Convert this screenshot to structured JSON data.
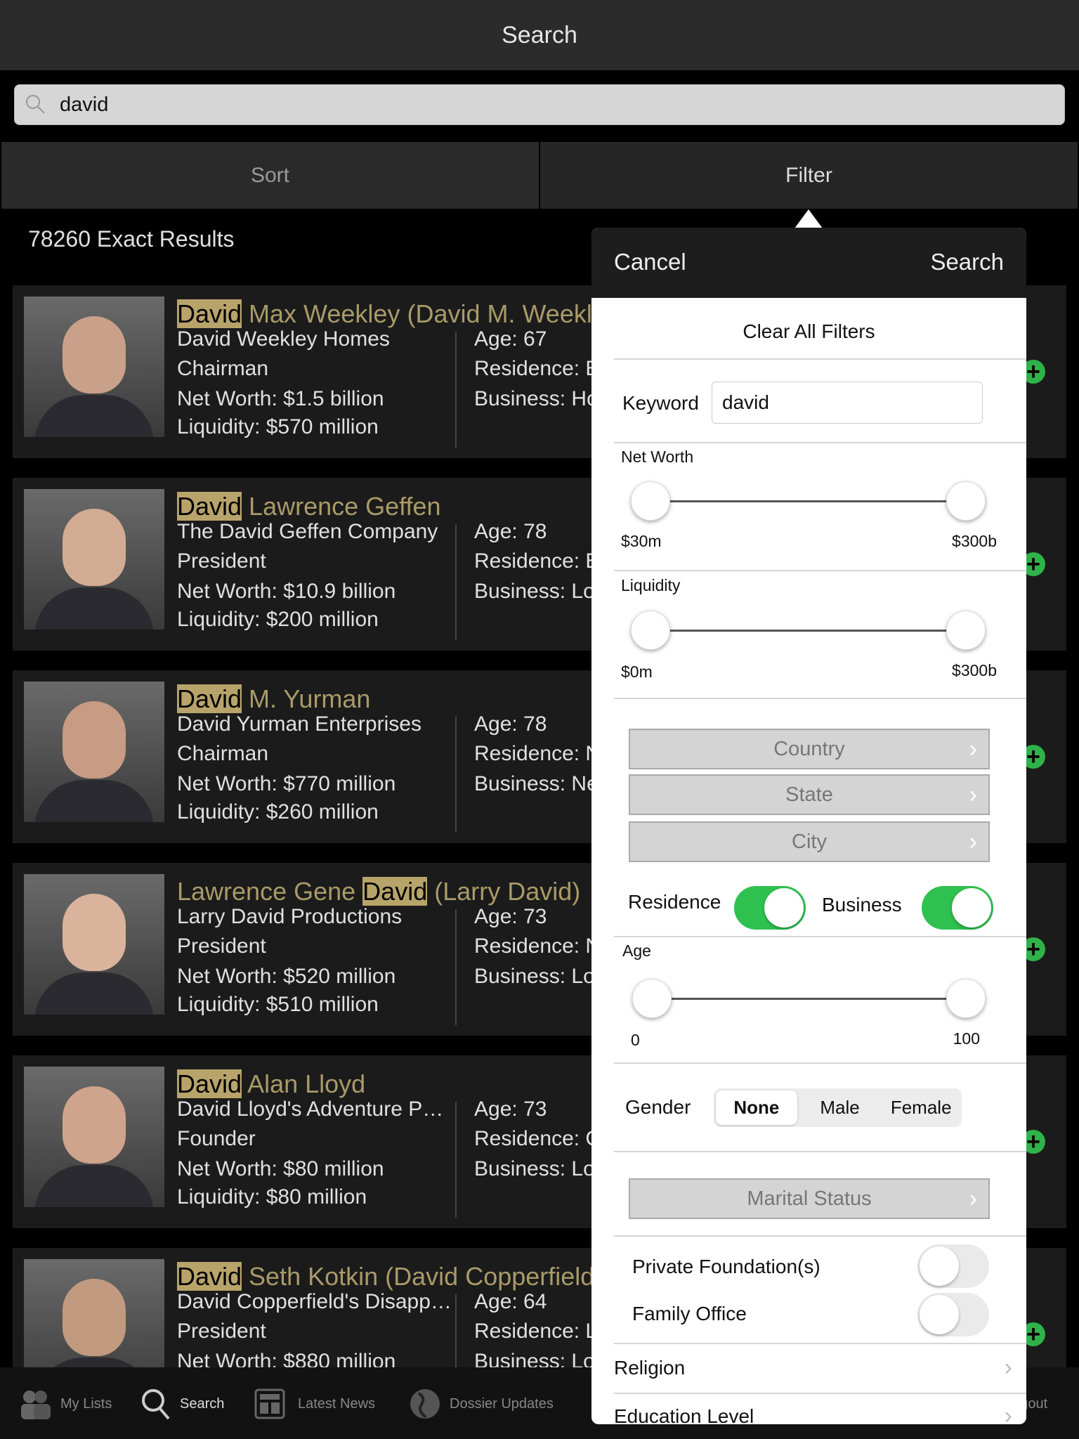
{
  "header": {
    "title": "Search"
  },
  "search": {
    "value": "david"
  },
  "segments": {
    "sort": "Sort",
    "filter": "Filter"
  },
  "results": {
    "count_label": "78260 Exact Results",
    "rows": [
      {
        "name_pre": "",
        "name_hl": "David",
        "name_post": " Max Weekley (David M. Weekl",
        "company": "David Weekley Homes",
        "title": "Chairman",
        "net_worth": "Net Worth: $1.5 billion",
        "liquidity": "Liquidity: $570 million",
        "age": "Age: 67",
        "residence": "Residence: B",
        "business": "Business: Ho"
      },
      {
        "name_pre": "",
        "name_hl": "David",
        "name_post": " Lawrence Geffen",
        "company": "The David Geffen Company",
        "title": "President",
        "net_worth": "Net Worth: $10.9 billion",
        "liquidity": "Liquidity: $200 million",
        "age": "Age: 78",
        "residence": "Residence: B",
        "business": "Business: Lo"
      },
      {
        "name_pre": "",
        "name_hl": "David",
        "name_post": " M. Yurman",
        "company": "David Yurman Enterprises",
        "title": "Chairman",
        "net_worth": "Net Worth: $770 million",
        "liquidity": "Liquidity: $260 million",
        "age": "Age: 78",
        "residence": "Residence: N",
        "business": "Business: Ne"
      },
      {
        "name_pre": "Lawrence Gene ",
        "name_hl": "David",
        "name_post": " (Larry David)",
        "company": "Larry David Productions",
        "title": "President",
        "net_worth": "Net Worth: $520 million",
        "liquidity": "Liquidity: $510 million",
        "age": "Age: 73",
        "residence": "Residence: N",
        "business": "Business: Lo"
      },
      {
        "name_pre": "",
        "name_hl": "David",
        "name_post": " Alan Lloyd",
        "company": "David Lloyd's Adventure P…",
        "title": "Founder",
        "net_worth": "Net Worth: $80 million",
        "liquidity": "Liquidity: $80 million",
        "age": "Age: 73",
        "residence": "Residence: C",
        "business": "Business: Lo"
      },
      {
        "name_pre": "",
        "name_hl": "David",
        "name_post": " Seth Kotkin (David Copperfield",
        "company": "David Copperfield's Disapp…",
        "title": "President",
        "net_worth": "Net Worth: $880 million",
        "liquidity": "",
        "age": "Age: 64",
        "residence": "Residence: L",
        "business": "Business: Lo"
      }
    ]
  },
  "filter": {
    "cancel": "Cancel",
    "search": "Search",
    "clear_all": "Clear All Filters",
    "keyword_label": "Keyword",
    "keyword_value": "david",
    "net_worth": {
      "label": "Net Worth",
      "min": "$30m",
      "max": "$300b"
    },
    "liquidity": {
      "label": "Liquidity",
      "min": "$0m",
      "max": "$300b"
    },
    "country": "Country",
    "state": "State",
    "city": "City",
    "residence": {
      "label": "Residence",
      "on": true
    },
    "business": {
      "label": "Business",
      "on": true
    },
    "age": {
      "label": "Age",
      "min": "0",
      "max": "100"
    },
    "gender": {
      "label": "Gender",
      "options": [
        "None",
        "Male",
        "Female"
      ],
      "selected": "None"
    },
    "marital_status": "Marital Status",
    "private_foundation": {
      "label": "Private Foundation(s)",
      "on": false
    },
    "family_office": {
      "label": "Family Office",
      "on": false
    },
    "religion": "Religion",
    "education": "Education Level"
  },
  "tabbar": {
    "items": [
      "My Lists",
      "Search",
      "Latest News",
      "Dossier Updates",
      "Logout"
    ]
  },
  "colors": {
    "highlight": "#b8a46a",
    "name": "#a99a68",
    "toggle_on": "#2fc150",
    "add": "#2fb24a"
  }
}
